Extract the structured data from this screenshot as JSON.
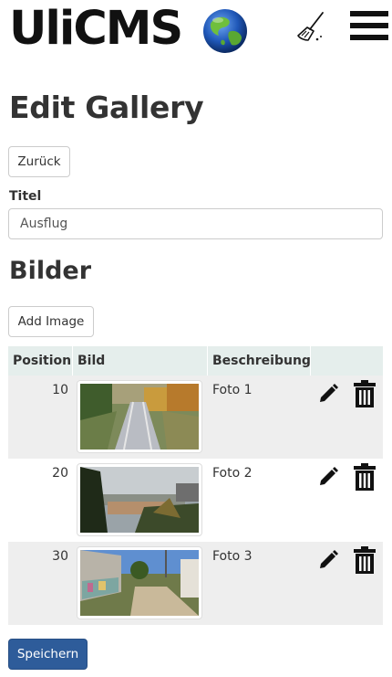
{
  "header": {
    "logo_text": "UliCMS",
    "globe_icon": "globe-icon",
    "clear_cache_icon": "broom-icon",
    "menu_icon": "hamburger-menu-icon"
  },
  "page": {
    "title": "Edit Gallery",
    "back_label": "Zurück",
    "title_label": "Titel",
    "title_value": "Ausflug",
    "images_heading": "Bilder",
    "add_image_label": "Add Image",
    "save_label": "Speichern"
  },
  "table": {
    "columns": [
      "Position",
      "Bild",
      "Beschreibung"
    ],
    "rows": [
      {
        "position": "10",
        "description": "Foto 1",
        "image": "railway-tracks-photo"
      },
      {
        "position": "20",
        "description": "Foto 2",
        "image": "city-view-photo"
      },
      {
        "position": "30",
        "description": "Foto 3",
        "image": "street-graffiti-photo"
      }
    ]
  },
  "colors": {
    "primary_button": "#2e5c9a",
    "table_header": "#e5eeec",
    "row_stripe": "#eeeeee"
  }
}
